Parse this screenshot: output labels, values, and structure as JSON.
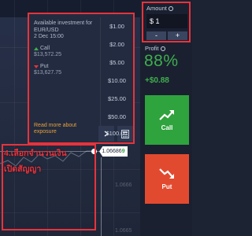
{
  "chart": {
    "axis_labels": [
      "1.0666",
      "1.0665"
    ],
    "price_prefix": "1.06686",
    "price_last": "9"
  },
  "invest_panel": {
    "available_label": "Available investment for",
    "pair": "EUR/USD",
    "expiry": "2 Dec 15:00",
    "call_label": "Call",
    "call_value": "$13,572.25",
    "put_label": "Put",
    "put_value": "$13,627.75",
    "read_more": "Read more about exposure",
    "amounts": [
      "$1.00",
      "$2.00",
      "$5.00",
      "$10.00",
      "$25.00",
      "$50.00",
      "$100.00"
    ]
  },
  "sidebar": {
    "amount_title": "Amount",
    "amount_value": "$ 1",
    "minus_label": "-",
    "plus_label": "+",
    "profit_title": "Profit",
    "profit_percent": "88%",
    "profit_amount": "+$0.88",
    "call_label": "Call",
    "put_label": "Put"
  },
  "annotation": {
    "line1": "4.เลือกจำนวนเงิน",
    "line2": "เปิดสัญญา"
  },
  "colors": {
    "highlight": "#e8333b",
    "call": "#2fa33d",
    "put": "#e24a2f",
    "profit": "#3fae4d"
  }
}
